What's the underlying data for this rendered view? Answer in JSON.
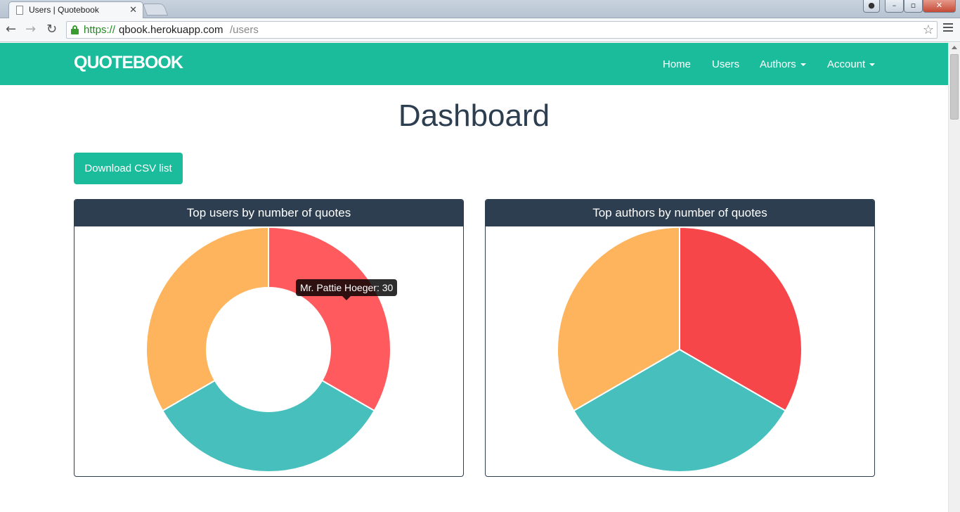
{
  "browser": {
    "tab_title": "Users | Quotebook",
    "url_scheme": "https://",
    "url_host": "qbook.herokuapp.com",
    "url_path": "/users"
  },
  "navbar": {
    "brand": "QUOTEBOOK",
    "links": [
      "Home",
      "Users",
      "Authors",
      "Account"
    ]
  },
  "page": {
    "title": "Dashboard",
    "csv_button": "Download CSV list"
  },
  "colors": {
    "brand": "#1abc9c",
    "panel_header": "#2c3e50",
    "red": "#f7464a",
    "red_hover": "#ff5a5e",
    "teal": "#46bfbd",
    "orange": "#fdb45c"
  },
  "chart_data": [
    {
      "type": "doughnut",
      "title": "Top users by number of quotes",
      "slices": [
        {
          "label": "Mr. Pattie Hoeger",
          "value": 30,
          "color": "#ff5a5e"
        },
        {
          "label": "",
          "value": 30,
          "color": "#46bfbd"
        },
        {
          "label": "",
          "value": 30,
          "color": "#fdb45c"
        }
      ],
      "tooltip": "Mr. Pattie Hoeger: 30"
    },
    {
      "type": "pie",
      "title": "Top authors by number of quotes",
      "slices": [
        {
          "label": "",
          "value": 1,
          "color": "#f7464a"
        },
        {
          "label": "",
          "value": 1,
          "color": "#46bfbd"
        },
        {
          "label": "",
          "value": 1,
          "color": "#fdb45c"
        }
      ]
    }
  ]
}
